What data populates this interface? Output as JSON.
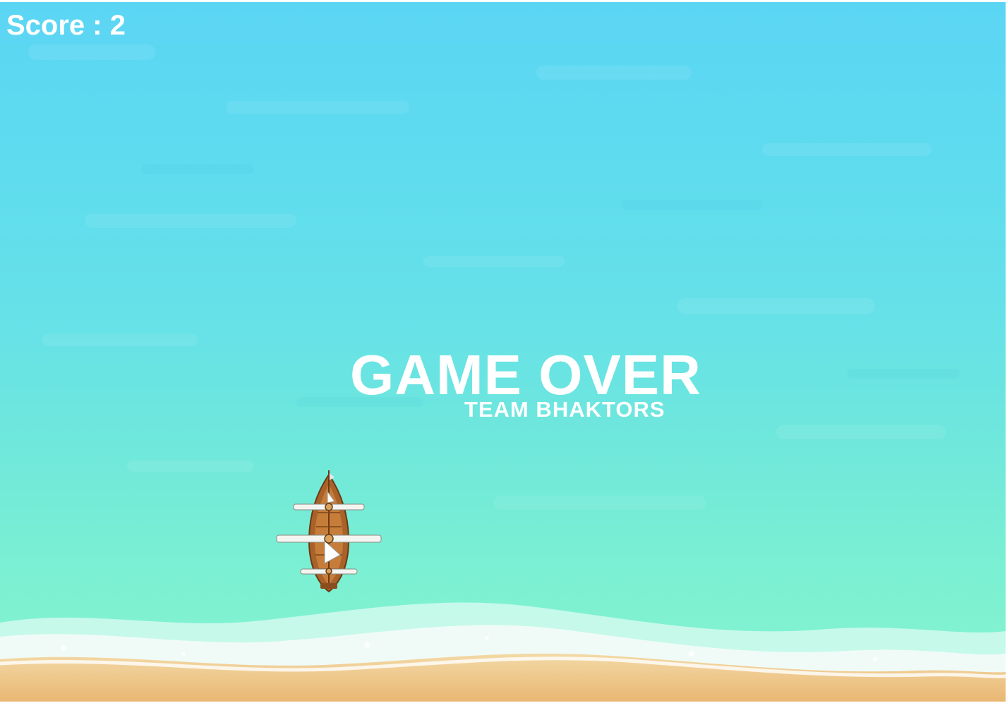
{
  "hud": {
    "score_text": "Score : 2",
    "score_value": 2
  },
  "game_over": {
    "title": "GAME OVER",
    "credit": "TEAM BHAKTORS"
  },
  "scene": {
    "ship_icon": "pirate-ship-icon",
    "colors": {
      "sea_top": "#5bd5f4",
      "sea_bottom": "#86f4cf",
      "foam": "#ffffff",
      "sand": "#f0c98a",
      "hud_text": "#ffffff",
      "ship_hull": "#a8622a"
    }
  }
}
